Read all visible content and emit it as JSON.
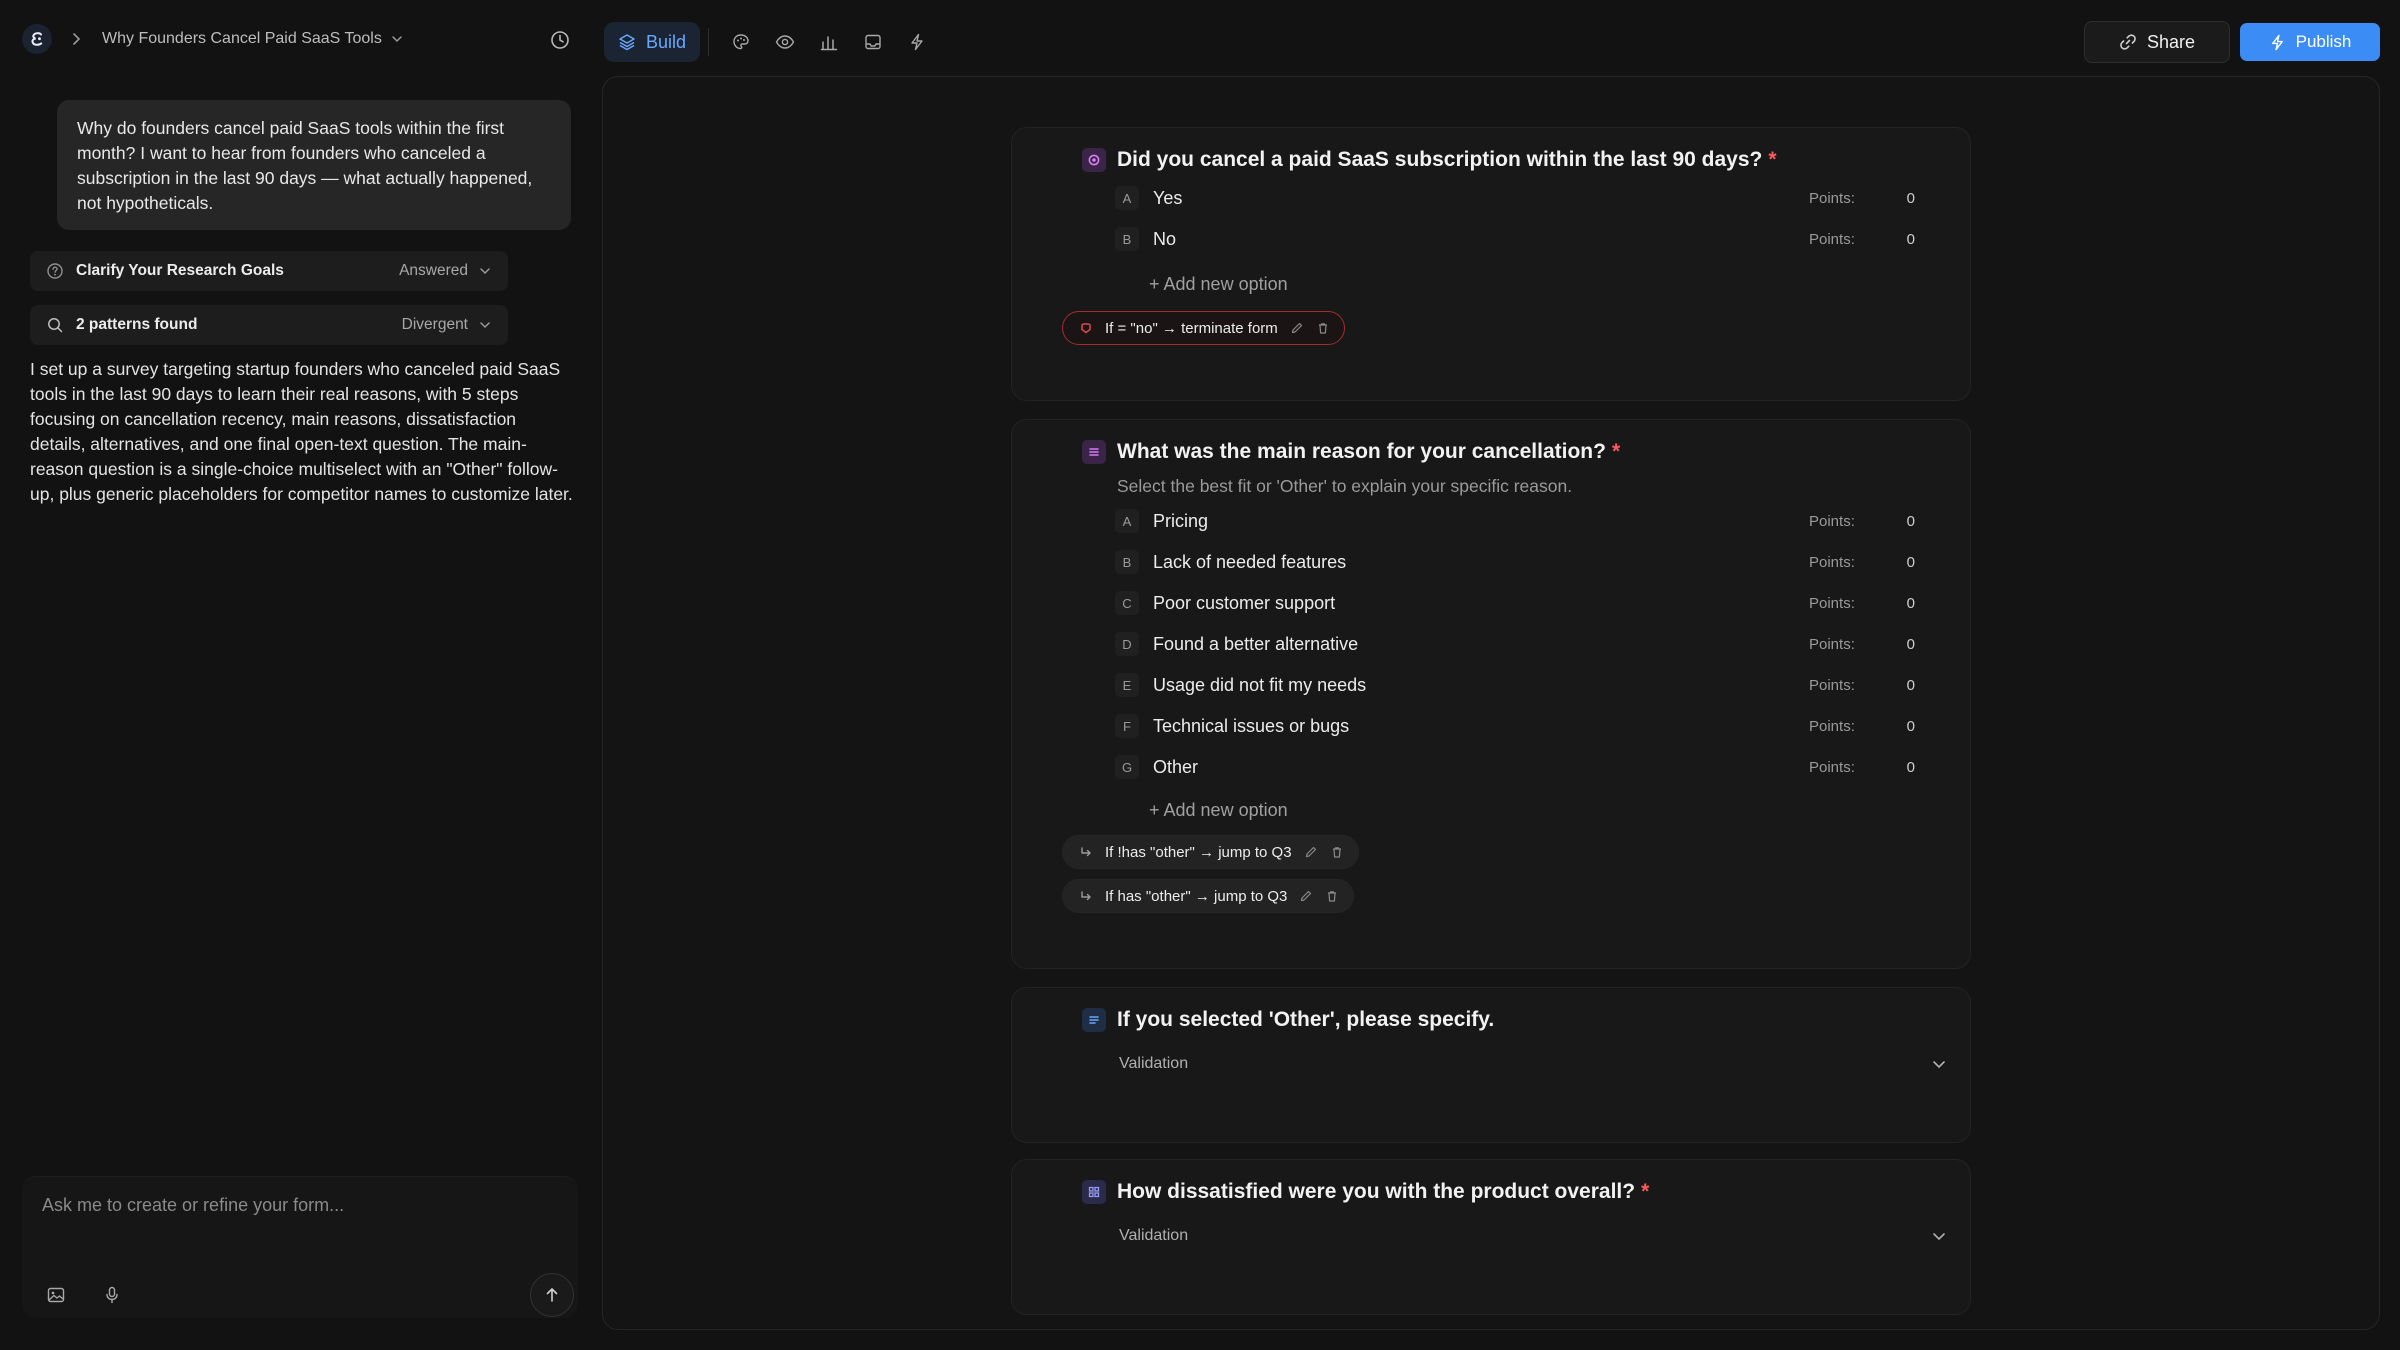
{
  "app": {
    "project_title": "Why Founders Cancel Paid SaaS Tools"
  },
  "toolbar": {
    "build_label": "Build",
    "share_label": "Share",
    "publish_label": "Publish",
    "accent_color": "#3b8cf5"
  },
  "chat": {
    "user_message": "Why do founders cancel paid SaaS tools within the first month? I want to hear from founders who canceled a subscription in the last 90 days — what actually happened, not hypotheticals.",
    "steps": [
      {
        "label": "Clarify Your Research Goals",
        "status": "Answered",
        "icon": "question-circle-icon"
      },
      {
        "label": "2 patterns found",
        "status": "Divergent",
        "icon": "search-icon"
      }
    ],
    "assistant_message": "I set up a survey targeting startup founders who canceled paid SaaS tools in the last 90 days to learn their real reasons, with 5 steps focusing on cancellation recency, main reasons, dissatisfaction details, alternatives, and one final open-text question. The main-reason question is a single-choice multiselect with an \"Other\" follow-up, plus generic placeholders for competitor names to customize later.",
    "composer_placeholder": "Ask me to create or refine your form..."
  },
  "questions": [
    {
      "title": "Did you cancel a paid SaaS subscription within the last 90 days?",
      "required_mark": "*",
      "badge_color": "#c86bf0",
      "options": [
        {
          "letter": "A",
          "label": "Yes",
          "points_label": "Points:",
          "points": "0"
        },
        {
          "letter": "B",
          "label": "No",
          "points_label": "Points:",
          "points": "0"
        }
      ],
      "add_option": "+ Add new option",
      "rules": [
        {
          "text": "If = \"no\" → terminate form",
          "kind": "terminate"
        }
      ]
    },
    {
      "title": "What was the main reason for your cancellation?",
      "required_mark": "*",
      "subtitle": "Select the best fit or 'Other' to explain your specific reason.",
      "badge_color": "#c86bf0",
      "options": [
        {
          "letter": "A",
          "label": "Pricing",
          "points_label": "Points:",
          "points": "0"
        },
        {
          "letter": "B",
          "label": "Lack of needed features",
          "points_label": "Points:",
          "points": "0"
        },
        {
          "letter": "C",
          "label": "Poor customer support",
          "points_label": "Points:",
          "points": "0"
        },
        {
          "letter": "D",
          "label": "Found a better alternative",
          "points_label": "Points:",
          "points": "0"
        },
        {
          "letter": "E",
          "label": "Usage did not fit my needs",
          "points_label": "Points:",
          "points": "0"
        },
        {
          "letter": "F",
          "label": "Technical issues or bugs",
          "points_label": "Points:",
          "points": "0"
        },
        {
          "letter": "G",
          "label": "Other",
          "points_label": "Points:",
          "points": "0"
        }
      ],
      "add_option": "+ Add new option",
      "rules": [
        {
          "text": "If !has \"other\" → jump to Q3",
          "kind": "jump"
        },
        {
          "text": "If has \"other\" → jump to Q3",
          "kind": "jump"
        }
      ]
    },
    {
      "title": "If you selected 'Other', please specify.",
      "badge_color": "#6aa8ff",
      "validation_label": "Validation"
    },
    {
      "title": "How dissatisfied were you with the product overall?",
      "required_mark": "*",
      "badge_color": "#8a8cf5",
      "validation_label": "Validation"
    }
  ]
}
